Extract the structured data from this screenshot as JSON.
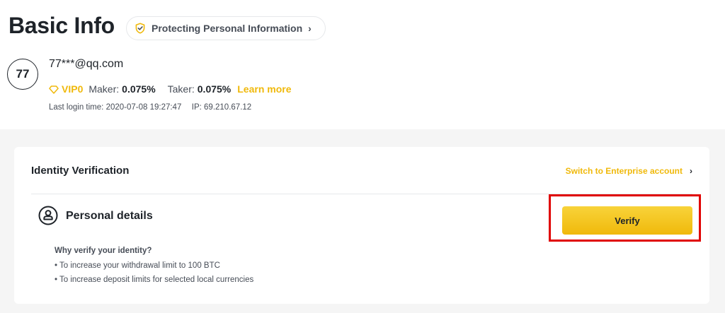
{
  "header": {
    "title": "Basic Info",
    "protect_label": "Protecting Personal Information",
    "protect_icon": "shield-check-icon"
  },
  "user": {
    "avatar_text": "77",
    "email": "77***@qq.com",
    "vip_label": "VIP0",
    "maker_label": "Maker:",
    "maker_value": "0.075%",
    "taker_label": "Taker:",
    "taker_value": "0.075%",
    "learn_more": "Learn more",
    "last_login_label": "Last login time:",
    "last_login_value": "2020-07-08 19:27:47",
    "ip_label": "IP:",
    "ip_value": "69.210.67.12"
  },
  "identity": {
    "title": "Identity Verification",
    "enterprise_link": "Switch to Enterprise account",
    "personal_title": "Personal details",
    "verify_label": "Verify",
    "why_title": "Why verify your identity?",
    "reasons": [
      "• To increase your withdrawal limit to 100 BTC",
      "• To increase deposit limits for selected local currencies"
    ]
  },
  "colors": {
    "brand": "#f0b90b",
    "highlight": "#e00000",
    "text": "#1e2329",
    "muted": "#474d57"
  }
}
